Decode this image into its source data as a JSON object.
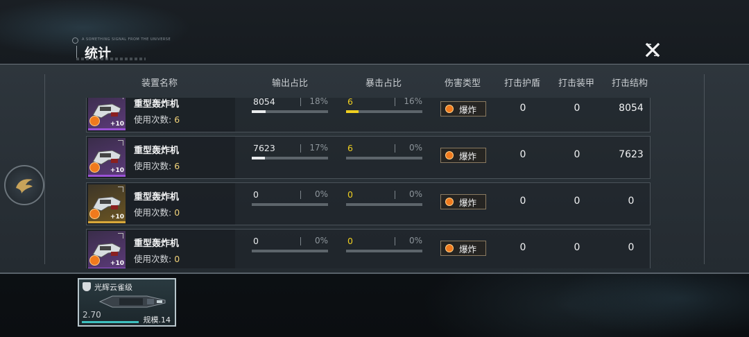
{
  "header": {
    "tag": "A SOMETHING SIGNAL FROM THE UNIVERSE",
    "title": "统计"
  },
  "columns": {
    "name": "装置名称",
    "output_ratio": "输出占比",
    "crit_ratio": "暴击占比",
    "damage_type": "伤害类型",
    "hit_shield": "打击护盾",
    "hit_armor": "打击装甲",
    "hit_structure": "打击结构"
  },
  "rows": [
    {
      "name": "重型轰炸机",
      "uses_label": "使用次数:",
      "uses": "6",
      "rarity": "purple",
      "level": "+10",
      "output": "8054",
      "output_pct": "18%",
      "output_fill": 0.18,
      "crit": "6",
      "crit_pct": "16%",
      "crit_fill": 0.16,
      "damage_type": "爆炸",
      "shield": "0",
      "armor": "0",
      "structure": "8054"
    },
    {
      "name": "重型轰炸机",
      "uses_label": "使用次数:",
      "uses": "6",
      "rarity": "purple",
      "level": "+10",
      "output": "7623",
      "output_pct": "17%",
      "output_fill": 0.17,
      "crit": "6",
      "crit_pct": "0%",
      "crit_fill": 0,
      "damage_type": "爆炸",
      "shield": "0",
      "armor": "0",
      "structure": "7623"
    },
    {
      "name": "重型轰炸机",
      "uses_label": "使用次数:",
      "uses": "0",
      "rarity": "gold",
      "level": "+10",
      "output": "0",
      "output_pct": "0%",
      "output_fill": 0,
      "crit": "0",
      "crit_pct": "0%",
      "crit_fill": 0,
      "damage_type": "爆炸",
      "shield": "0",
      "armor": "0",
      "structure": "0"
    },
    {
      "name": "重型轰炸机",
      "uses_label": "使用次数:",
      "uses": "0",
      "rarity": "purple",
      "level": "+10",
      "output": "0",
      "output_pct": "0%",
      "output_fill": 0,
      "crit": "0",
      "crit_pct": "0%",
      "crit_fill": 0,
      "damage_type": "爆炸",
      "shield": "0",
      "armor": "0",
      "structure": "0"
    }
  ],
  "ship_card": {
    "name": "光辉云雀级",
    "cost": "2.70",
    "scale": "规模.14"
  },
  "icons": {
    "close": "close-x-icon",
    "side": "bird-emblem-icon",
    "explosion": "explosion-icon",
    "ship_class": "shield-icon"
  },
  "colors": {
    "crit_yellow": "#f0d020",
    "rarity_purple": "#9a52d6",
    "rarity_gold": "#d8a83a",
    "explosion_orange": "#f07a1d"
  }
}
